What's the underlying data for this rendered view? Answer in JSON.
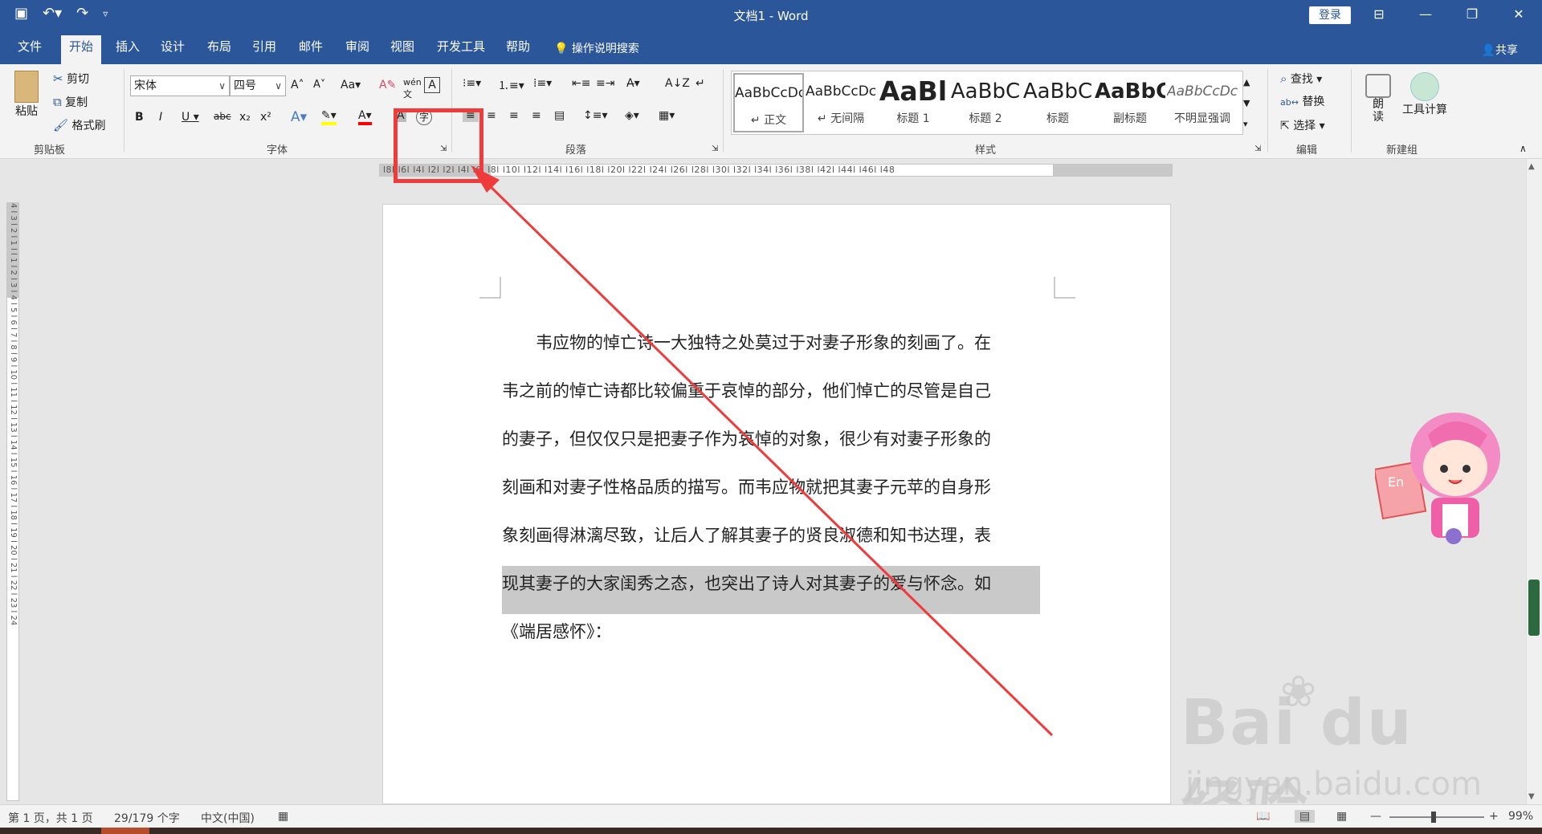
{
  "titlebar": {
    "title": "文档1 - Word",
    "login": "登录",
    "qat": {
      "save_icon": "save-icon",
      "undo_icon": "undo-icon",
      "redo_icon": "redo-icon",
      "customize_icon": "customize-icon"
    }
  },
  "tabs": [
    "文件",
    "开始",
    "插入",
    "设计",
    "布局",
    "引用",
    "邮件",
    "审阅",
    "视图",
    "开发工具",
    "帮助"
  ],
  "tellme": "操作说明搜索",
  "share": "共享",
  "ribbon": {
    "clipboard": {
      "paste": "粘贴",
      "cut": "剪切",
      "copy": "复制",
      "format_painter": "格式刷",
      "label": "剪贴板"
    },
    "font": {
      "family": "宋体",
      "size": "四号",
      "label": "字体"
    },
    "paragraph": {
      "label": "段落"
    },
    "styles": {
      "label": "样式",
      "items": [
        {
          "sample": "AaBbCcDc",
          "name": "↵ 正文"
        },
        {
          "sample": "AaBbCcDc",
          "name": "↵ 无间隔"
        },
        {
          "sample": "AaBl",
          "name": "标题 1"
        },
        {
          "sample": "AaBbC",
          "name": "标题 2"
        },
        {
          "sample": "AaBbC",
          "name": "标题"
        },
        {
          "sample": "AaBbC",
          "name": "副标题"
        },
        {
          "sample": "AaBbCcDc",
          "name": "不明显强调"
        }
      ]
    },
    "editing": {
      "find": "查找",
      "replace": "替换",
      "select": "选择",
      "label": "编辑"
    },
    "newgroup": {
      "read": "朗读",
      "calc": "工具计算",
      "label": "新建组"
    }
  },
  "ruler": {
    "numbers": "l8l l6l l4l l2l  l2l l4l l6l l8l l10l l12l l14l l16l l18l l20l l22l l24l l26l l28l l30l l32l l34l l36l l38l  l42l l44l l46l l48"
  },
  "vruler": "4 l 3 l 2 l 1 l  l 1 l 2 l 3 l 4 l 5 l 6 l 7 l 8 l 9 l 10 l 11 l 12 l 13 l 14 l 15 l 16 l 17 l 18 l 19 l 20 l 21 l 22 l 23 l 24",
  "document": {
    "lines": [
      "韦应物的悼亡诗一大独特之处莫过于对妻子形象的刻画了。在",
      "韦之前的悼亡诗都比较偏重于哀悼的部分，他们悼亡的尽管是自己",
      "的妻子，但仅仅只是把妻子作为哀悼的对象，很少有对妻子形象的",
      "刻画和对妻子性格品质的描写。而韦应物就把其妻子元苹的自身形",
      "象刻画得淋漓尽致，让后人了解其妻子的贤良淑德和知书达理，表",
      "现其妻子的大家闺秀之态，也突出了诗人对其妻子的爱与怀念。如",
      "《端居感怀》："
    ],
    "highlighted_line": 5
  },
  "statusbar": {
    "page": "第 1 页，共 1 页",
    "words": "29/179 个字",
    "lang": "中文(中国)",
    "zoom": "99%"
  },
  "watermark": {
    "main": "Bai du 经验",
    "sub": "jingyan.baidu.com"
  },
  "colors": {
    "word_blue": "#2b579a",
    "annotation_red": "#ef3b3b",
    "highlight_gray": "#c9c9c9"
  }
}
